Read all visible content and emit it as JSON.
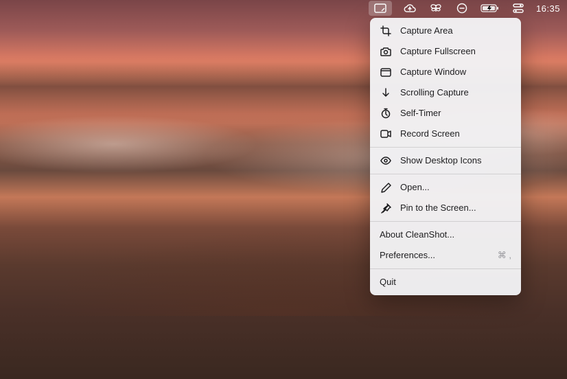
{
  "menubar": {
    "clock": "16:35"
  },
  "dropdown": {
    "items": [
      {
        "label": "Capture Area"
      },
      {
        "label": "Capture Fullscreen"
      },
      {
        "label": "Capture Window"
      },
      {
        "label": "Scrolling Capture"
      },
      {
        "label": "Self-Timer"
      },
      {
        "label": "Record Screen"
      }
    ],
    "show_desktop": "Show Desktop Icons",
    "open": "Open...",
    "pin": "Pin to the Screen...",
    "about": "About CleanShot...",
    "preferences": "Preferences...",
    "preferences_shortcut": "⌘ ,",
    "quit": "Quit"
  }
}
